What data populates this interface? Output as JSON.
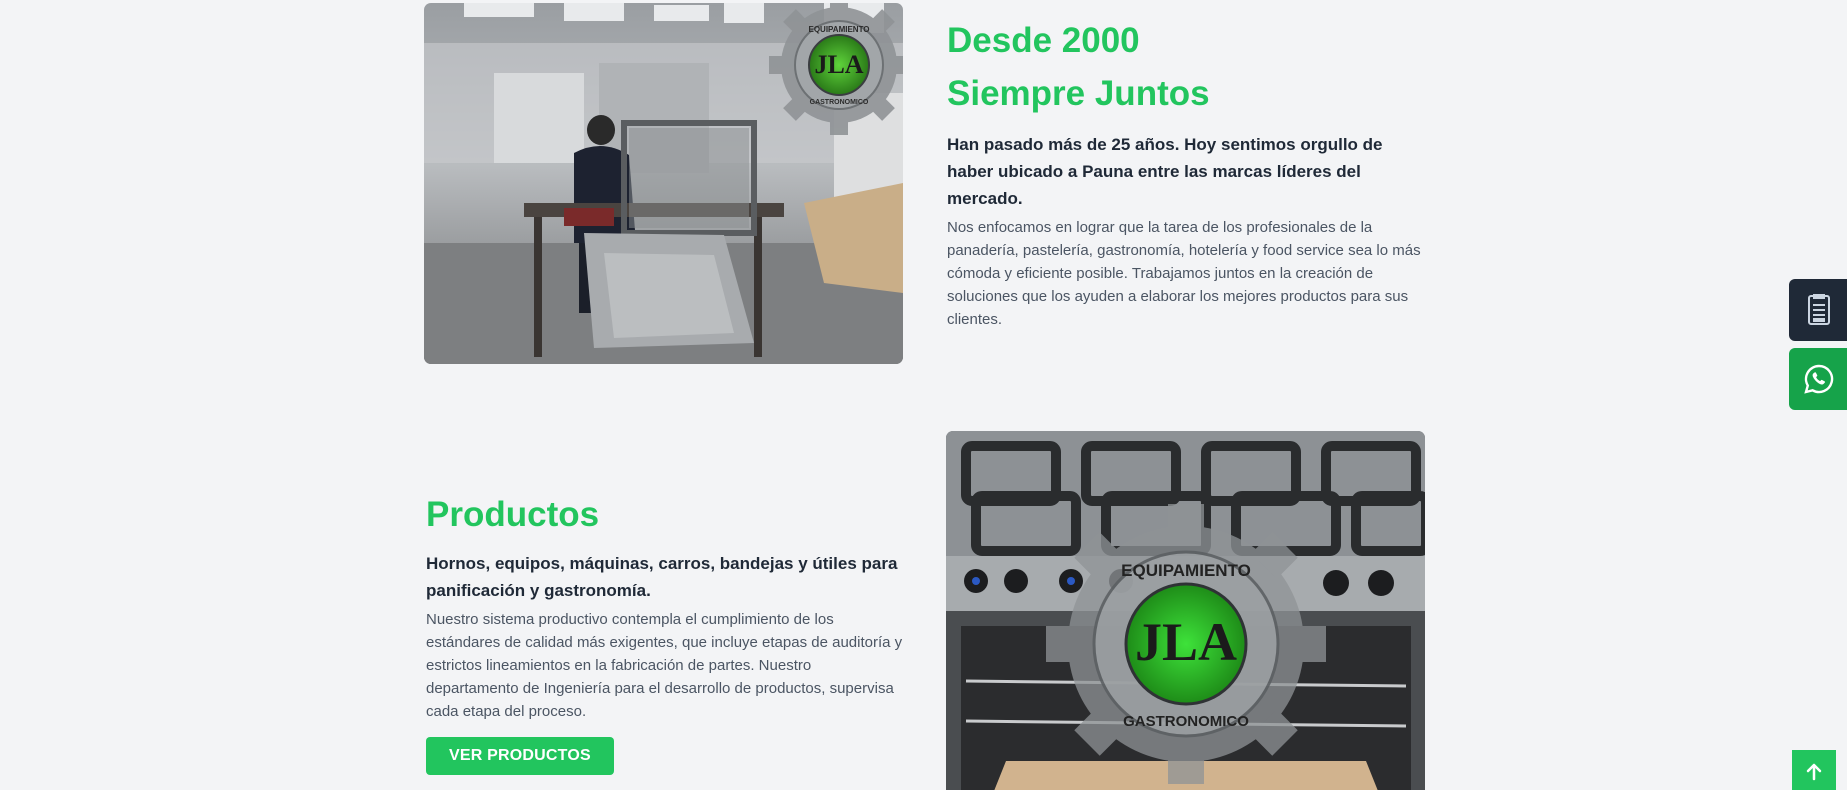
{
  "about": {
    "heading_line1": "Desde 2000",
    "heading_line2": "Siempre Juntos",
    "lead": "Han pasado más de 25 años. Hoy sentimos orgullo de haber ubicado a Pauna entre las marcas líderes del mercado.",
    "body": "Nos enfocamos en lograr que la tarea de los profesionales de la panadería, pastelería, gastronomía, hotelería y food service sea lo más cómoda y eficiente posible. Trabajamos juntos en la creación de soluciones que los ayuden a elaborar los mejores productos para sus clientes.",
    "image_logo_line1": "EQUIPAMIENTO",
    "image_logo_main": "JLA",
    "image_logo_line2": "GASTRONOMICO"
  },
  "products": {
    "heading": "Productos",
    "lead": "Hornos, equipos, máquinas, carros, bandejas y útiles para panificación y gastronomía.",
    "body": "Nuestro sistema productivo contempla el cumplimiento de los estándares de calidad más exigentes, que incluye etapas de auditoría y estrictos lineamientos en la fabricación de partes. Nuestro departamento de Ingeniería para el desarrollo de productos, supervisa cada etapa del proceso.",
    "button_label": "VER PRODUCTOS",
    "image_logo_line1": "EQUIPAMIENTO",
    "image_logo_main": "JLA",
    "image_logo_line2": "GASTRONOMICO"
  },
  "floating": {
    "catalog_icon": "catalog-icon",
    "whatsapp_icon": "whatsapp-icon",
    "scroll_top_icon": "arrow-up-icon"
  },
  "colors": {
    "accent": "#22c55e",
    "whatsapp": "#16a34a",
    "dark": "#1f2937",
    "background": "#f3f4f6"
  }
}
